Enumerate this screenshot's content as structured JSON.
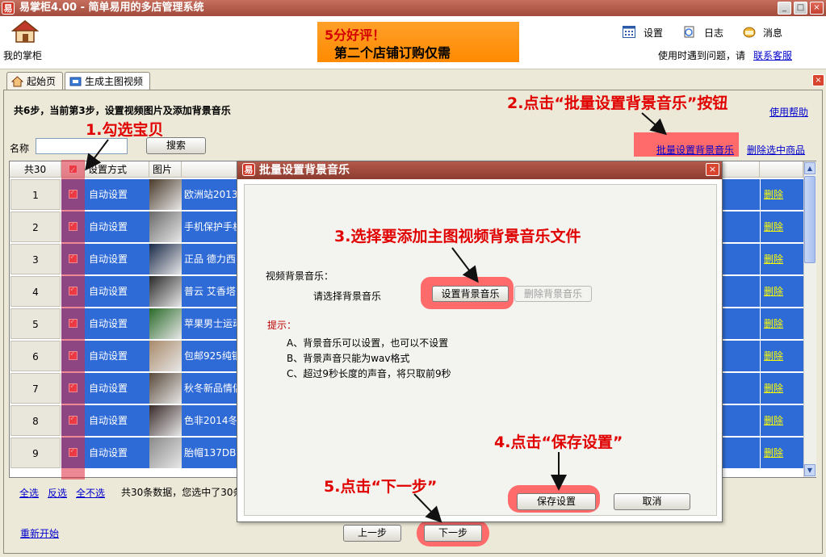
{
  "window": {
    "title": "易掌柜4.00 - 简单易用的多店管理系统",
    "logo_char": "易",
    "min_label": "_",
    "max_label": "□",
    "close_label": "×"
  },
  "header": {
    "home_label": "我的掌柜",
    "banner_line1": "5分好评！",
    "banner_line2": "第二个店铺订购仅需",
    "settings_label": "设置",
    "log_label": "日志",
    "message_label": "消息",
    "help_text": "使用时遇到问题，请",
    "contact_link": "联系客服"
  },
  "tabs": [
    {
      "label": "起始页"
    },
    {
      "label": "生成主图视频"
    }
  ],
  "tab_close_label": "×",
  "main": {
    "step_text": "共6步，当前第3步，设置视频图片及添加背景音乐",
    "use_help": "使用帮助",
    "name_label": "名称",
    "name_value": "",
    "search_button": "搜索",
    "batch_music_button": "批量设置背景音乐",
    "delete_selected": "删除选中商品"
  },
  "table": {
    "headers": {
      "count": "共30",
      "mode": "设置方式",
      "image": "图片"
    },
    "rows": [
      {
        "num": "1",
        "mode": "自动设置",
        "title": "欧洲站2013",
        "action": "删除"
      },
      {
        "num": "2",
        "mode": "自动设置",
        "title": "手机保护手机",
        "action": "删除"
      },
      {
        "num": "3",
        "mode": "自动设置",
        "title": "正品 德力西",
        "action": "删除"
      },
      {
        "num": "4",
        "mode": "自动设置",
        "title": "普云 艾香塔",
        "action": "删除"
      },
      {
        "num": "5",
        "mode": "自动设置",
        "title": "苹果男士运动",
        "action": "删除"
      },
      {
        "num": "6",
        "mode": "自动设置",
        "title": "包邮925纯银",
        "action": "删除"
      },
      {
        "num": "7",
        "mode": "自动设置",
        "title": "秋冬新品情侣",
        "action": "删除"
      },
      {
        "num": "8",
        "mode": "自动设置",
        "title": "色非2014冬",
        "action": "删除"
      },
      {
        "num": "9",
        "mode": "自动设置",
        "title": "胎帽137DB",
        "action": "删除"
      }
    ]
  },
  "footer": {
    "select_all": "全选",
    "select_invert": "反选",
    "select_none": "全不选",
    "count_text": "共30条数据，您选中了30条",
    "restart": "重新开始",
    "prev": "上一步",
    "next": "下一步"
  },
  "dialog": {
    "title": "批量设置背景音乐",
    "logo_char": "易",
    "close_label": "×",
    "music_label": "视频背景音乐：",
    "music_value": "请选择背景音乐",
    "set_music": "设置背景音乐",
    "delete_music": "删除背景音乐",
    "tip_label": "提示：",
    "tips": [
      "A、背景音乐可以设置，也可以不设置",
      "B、背景声音只能为wav格式",
      "C、超过9秒长度的声音，将只取前9秒"
    ],
    "save": "保存设置",
    "cancel": "取消"
  },
  "annotations": {
    "a1": "1.勾选宝贝",
    "a2": "2.点击“批量设置背景音乐”按钮",
    "a3": "3.选择要添加主图视频背景音乐文件",
    "a4": "4.点击“保存设置”",
    "a5": "5.点击“下一步”"
  }
}
